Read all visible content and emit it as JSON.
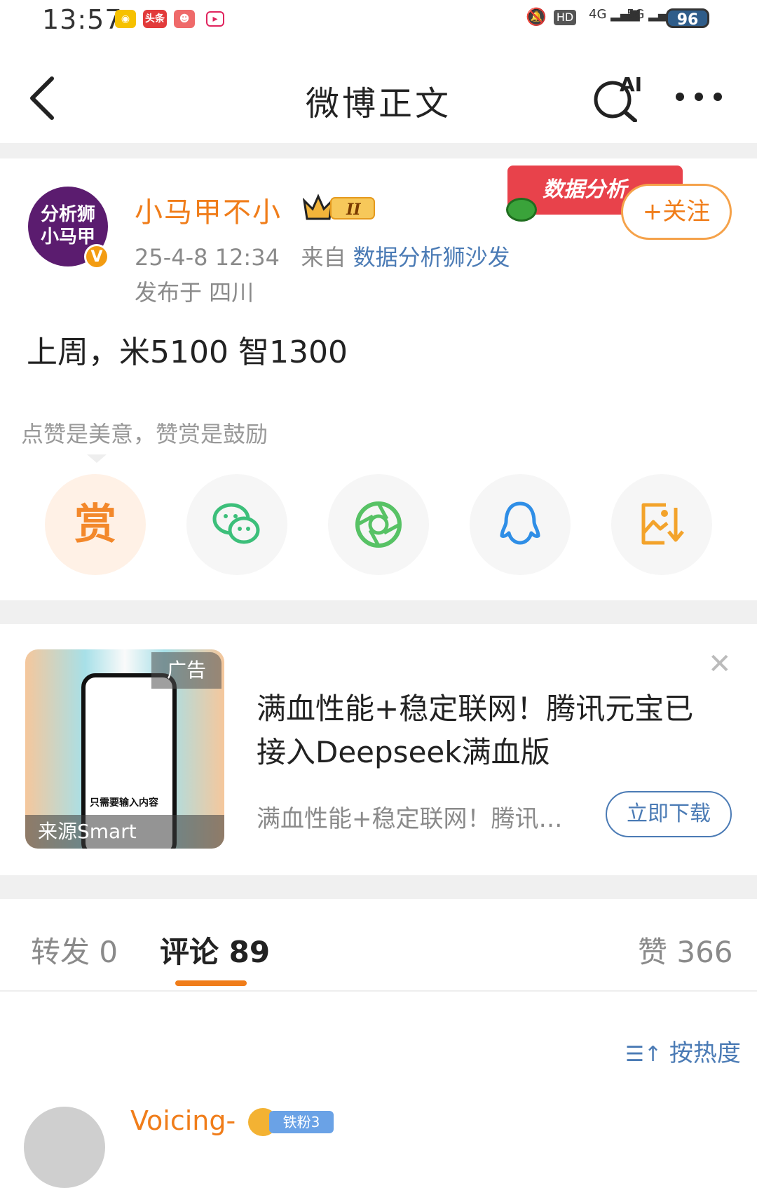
{
  "status_bar": {
    "time": "13:57",
    "apps": [
      "weibo-icon",
      "toutiao-icon",
      "game-icon",
      "video-icon"
    ],
    "toutiao_label": "头条",
    "network": [
      "4G",
      "5G"
    ],
    "battery": "96"
  },
  "nav": {
    "title": "微博正文",
    "ai_label": "AI"
  },
  "post": {
    "avatar_text_line1": "分析狮",
    "avatar_text_line2": "小马甲",
    "author": "小马甲不小",
    "level_badge": "II",
    "date": "25-4-8 12:34",
    "from_prefix": "来自",
    "source": "数据分析狮沙发",
    "location": "发布于 四川",
    "banner_text": "数据分析",
    "follow_label": "+关注",
    "content": "上周，米5100  智1300"
  },
  "reward": {
    "hint": "点赞是美意，赞赏是鼓励",
    "reward_label": "赏"
  },
  "ad": {
    "tag": "广告",
    "source": "来源Smart",
    "caption": "只需要输入内容",
    "title": "满血性能+稳定联网！腾讯元宝已接入Deepseek满血版",
    "desc": "满血性能+稳定联网！腾讯…",
    "button": "立即下载"
  },
  "tabs": {
    "repost": "转发 0",
    "comments": "评论 89",
    "likes": "赞 366"
  },
  "sort_label": "按热度",
  "comment": {
    "username": "Voicing-",
    "badge": "铁粉3"
  },
  "colors": {
    "accent_orange": "#f07d1a",
    "link_blue": "#4b7bb5",
    "wechat_green": "#3cbf7a",
    "moments_green": "#57c265",
    "qq_blue": "#2f8ee6",
    "save_orange": "#f3a32b"
  }
}
